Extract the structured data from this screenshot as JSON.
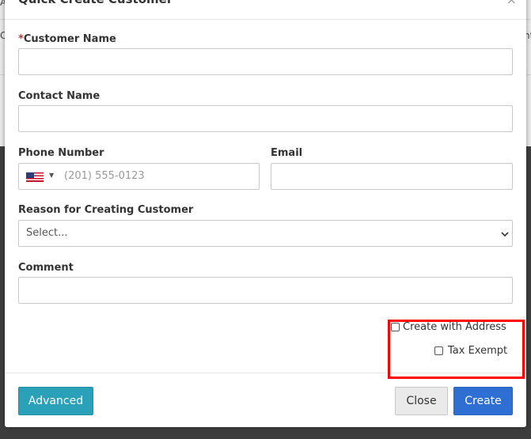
{
  "background": {
    "left_fragment": "A",
    "left_fragment2": "C",
    "right_fragment": "nt"
  },
  "modal": {
    "title": "Quick Create Customer",
    "close_glyph": "×"
  },
  "form": {
    "customer_name": {
      "required_mark": "*",
      "label": "Customer Name",
      "value": ""
    },
    "contact_name": {
      "label": "Contact Name",
      "value": ""
    },
    "phone": {
      "label": "Phone Number",
      "country": "US",
      "caret": "▼",
      "placeholder": "(201) 555-0123",
      "value": ""
    },
    "email": {
      "label": "Email",
      "value": ""
    },
    "reason": {
      "label": "Reason for Creating Customer",
      "selected": "Select..."
    },
    "comment": {
      "label": "Comment",
      "value": ""
    },
    "create_with_address": {
      "label": "Create with Address",
      "checked": false
    },
    "tax_exempt": {
      "label": "Tax Exempt",
      "checked": false
    }
  },
  "footer": {
    "advanced_label": "Advanced",
    "close_label": "Close",
    "create_label": "Create"
  },
  "colors": {
    "advanced_button": "#2aa0b9",
    "create_button": "#2f6fd4",
    "highlight": "#ff0000",
    "required": "#a94442"
  }
}
